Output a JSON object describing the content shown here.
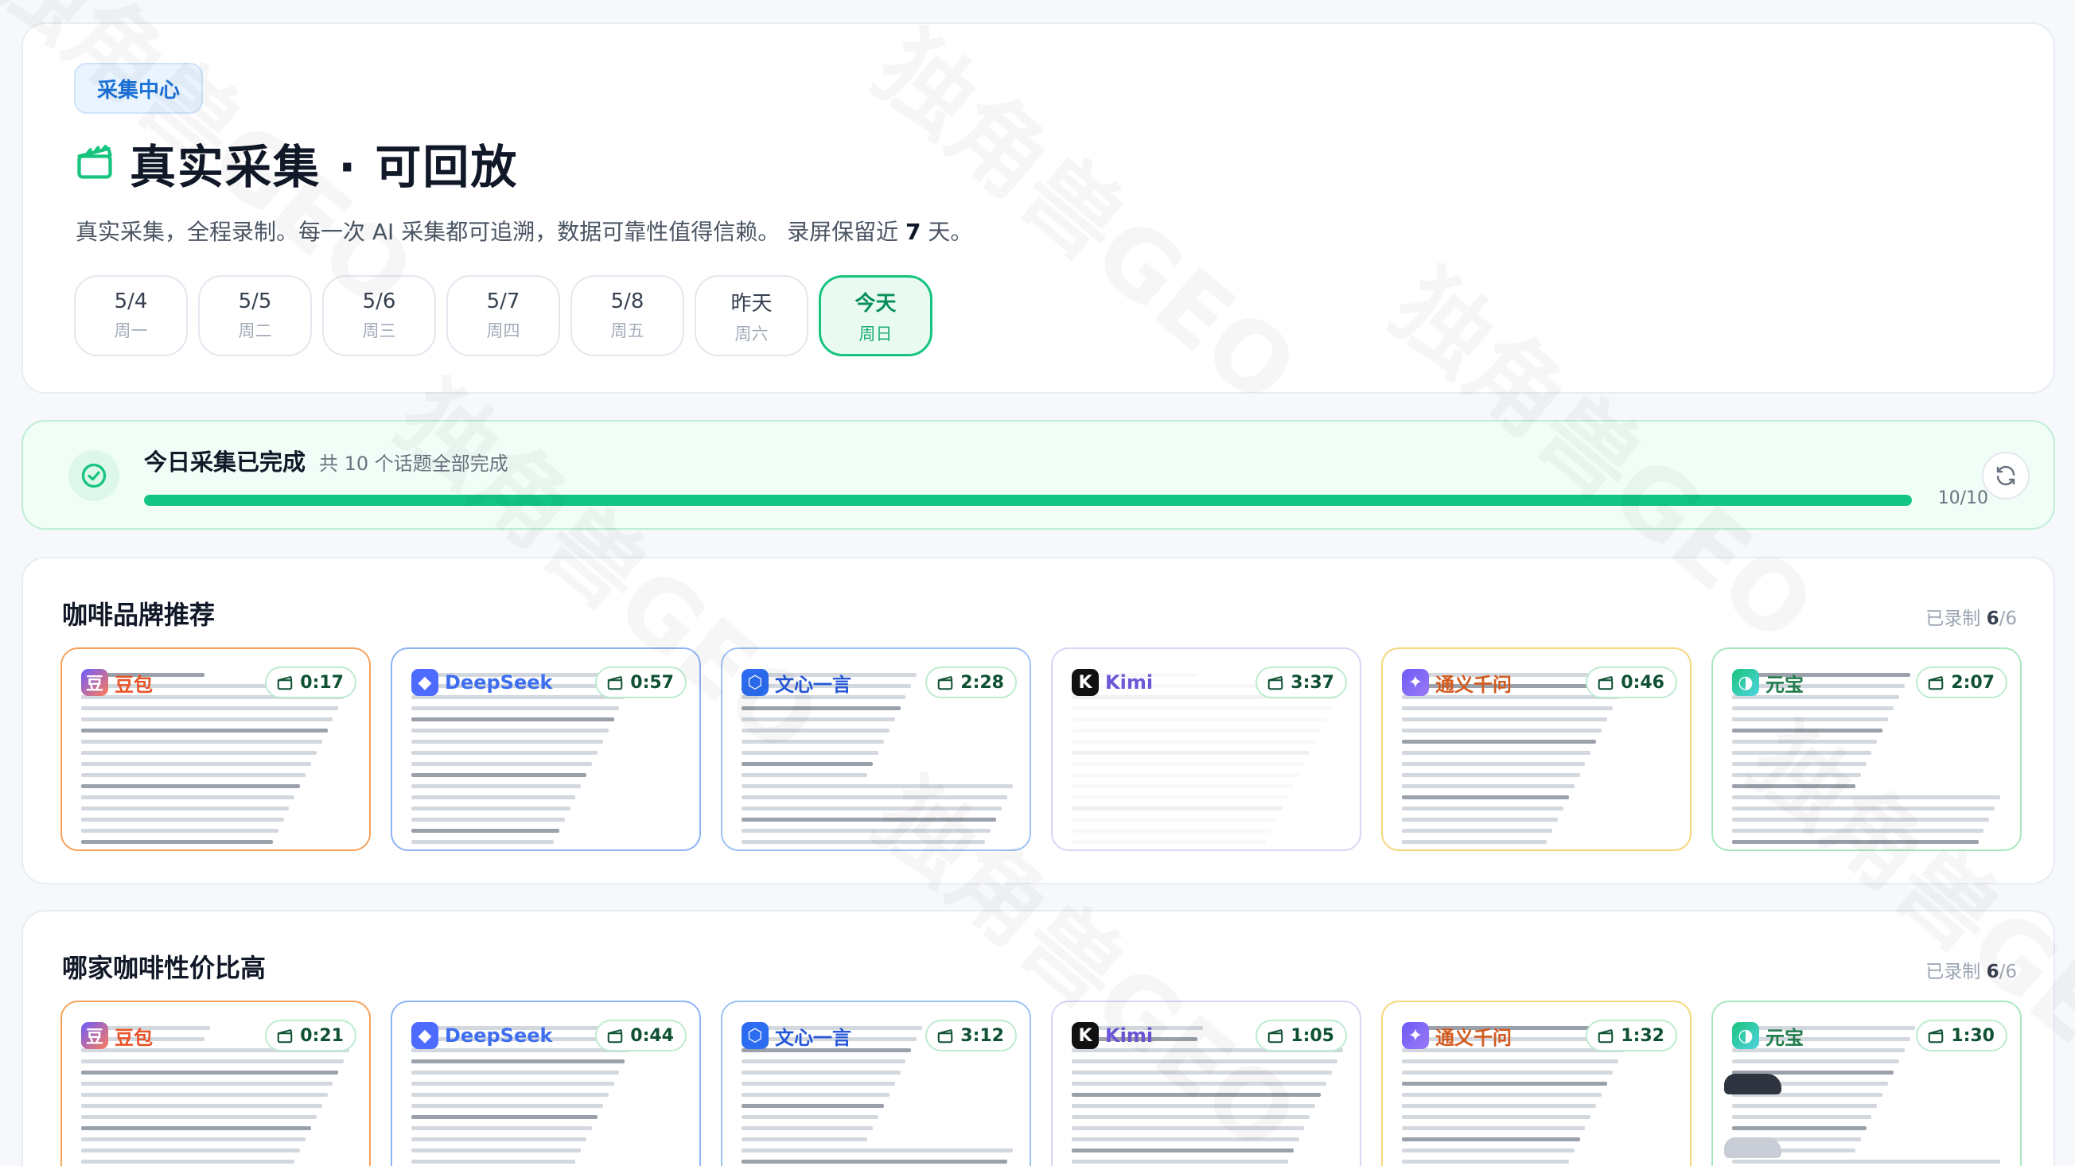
{
  "hero": {
    "tag": "采集中心",
    "title": "真实采集 · 可回放",
    "desc_prefix": "真实采集，全程录制。每一次 AI 采集都可追溯，数据可靠性值得信赖。 录屏保留近 ",
    "desc_days": "7",
    "desc_suffix": " 天。",
    "days": [
      {
        "date": "5/4",
        "week": "周一"
      },
      {
        "date": "5/5",
        "week": "周二"
      },
      {
        "date": "5/6",
        "week": "周三"
      },
      {
        "date": "5/7",
        "week": "周四"
      },
      {
        "date": "5/8",
        "week": "周五"
      },
      {
        "date": "昨天",
        "week": "周六"
      },
      {
        "date": "今天",
        "week": "周日"
      }
    ]
  },
  "status": {
    "title": "今日采集已完成",
    "subtitle": "共 10 个话题全部完成",
    "done": 10,
    "total": 10,
    "count_text": "10/10"
  },
  "topics": [
    {
      "title": "咖啡品牌推荐",
      "recorded_label": "已录制",
      "recorded_num": "6",
      "recorded_total": "/6",
      "items": [
        {
          "name": "豆包",
          "duration": "0:17"
        },
        {
          "name": "DeepSeek",
          "duration": "0:57"
        },
        {
          "name": "文心一言",
          "duration": "2:28"
        },
        {
          "name": "Kimi",
          "duration": "3:37"
        },
        {
          "name": "通义千问",
          "duration": "0:46"
        },
        {
          "name": "元宝",
          "duration": "2:07"
        }
      ]
    },
    {
      "title": "哪家咖啡性价比高",
      "recorded_label": "已录制",
      "recorded_num": "6",
      "recorded_total": "/6",
      "items": [
        {
          "name": "豆包",
          "duration": "0:21"
        },
        {
          "name": "DeepSeek",
          "duration": "0:44"
        },
        {
          "name": "文心一言",
          "duration": "3:12"
        },
        {
          "name": "Kimi",
          "duration": "1:05"
        },
        {
          "name": "通义千问",
          "duration": "1:32"
        },
        {
          "name": "元宝",
          "duration": "1:30"
        }
      ]
    }
  ],
  "colors": {
    "accent": "#16c47f",
    "doubao": "#f5a25d",
    "deepseek": "#8eb4f5",
    "wenxin": "#9cc3f5",
    "kimi": "#d9d5f5",
    "tongyi": "#f5d67a",
    "yuanbao": "#a8e8c0"
  }
}
